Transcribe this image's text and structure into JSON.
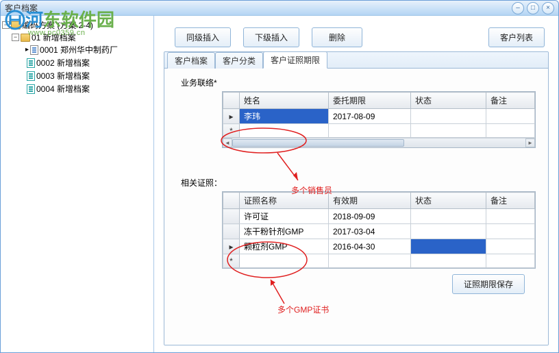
{
  "window": {
    "title": "客户档案"
  },
  "watermark": {
    "brand_prefix": "河",
    "brand_suffix": "东软件园",
    "url": "www.pc0359.cn"
  },
  "titlebar": {
    "minimize": "–",
    "maximize": "□",
    "close": "×"
  },
  "tree": {
    "root": {
      "label": "编码方案 (方案 2-4)"
    },
    "node1": {
      "label": "01 新增档案"
    },
    "children": [
      {
        "code": "0001",
        "label": "郑州华中制药厂",
        "marker": "▸",
        "iconClass": "icon-page"
      },
      {
        "code": "0002",
        "label": "新增档案",
        "marker": "",
        "iconClass": "icon-page teal"
      },
      {
        "code": "0003",
        "label": "新增档案",
        "marker": "",
        "iconClass": "icon-page teal"
      },
      {
        "code": "0004",
        "label": "新增档案",
        "marker": "",
        "iconClass": "icon-page teal"
      }
    ]
  },
  "toolbar": {
    "insert_same": "同级插入",
    "insert_child": "下级插入",
    "delete": "删除",
    "customer_list": "客户列表"
  },
  "tabs": {
    "t1": "客户档案",
    "t2": "客户分类",
    "t3": "客户证照期限"
  },
  "section1": {
    "label": "业务联络*",
    "cols": {
      "c1": "姓名",
      "c2": "委托期限",
      "c3": "状态",
      "c4": "备注"
    },
    "rows": [
      {
        "marker": "▸",
        "c1": "李玮",
        "c2": "2017-08-09",
        "c3": "",
        "c4": "",
        "sel": true
      },
      {
        "marker": "*",
        "c1": "",
        "c2": "",
        "c3": "",
        "c4": ""
      }
    ]
  },
  "section2": {
    "label": "相关证照：",
    "cols": {
      "c1": "证照名称",
      "c2": "有效期",
      "c3": "状态",
      "c4": "备注"
    },
    "rows": [
      {
        "marker": "",
        "c1": "许可证",
        "c2": "2018-09-09",
        "c3": "",
        "c4": ""
      },
      {
        "marker": "",
        "c1": "冻干粉针剂GMP",
        "c2": "2017-03-04",
        "c3": "",
        "c4": ""
      },
      {
        "marker": "▸",
        "c1": "颗粒剂GMP",
        "c2": "2016-04-30",
        "c3_sel": true,
        "c3": "",
        "c4": ""
      },
      {
        "marker": "*",
        "c1": "",
        "c2": "",
        "c3": "",
        "c4": ""
      }
    ]
  },
  "footer": {
    "save": "证照期限保存"
  },
  "annotations": {
    "a1": "多个销售员",
    "a2": "多个GMP证书"
  }
}
